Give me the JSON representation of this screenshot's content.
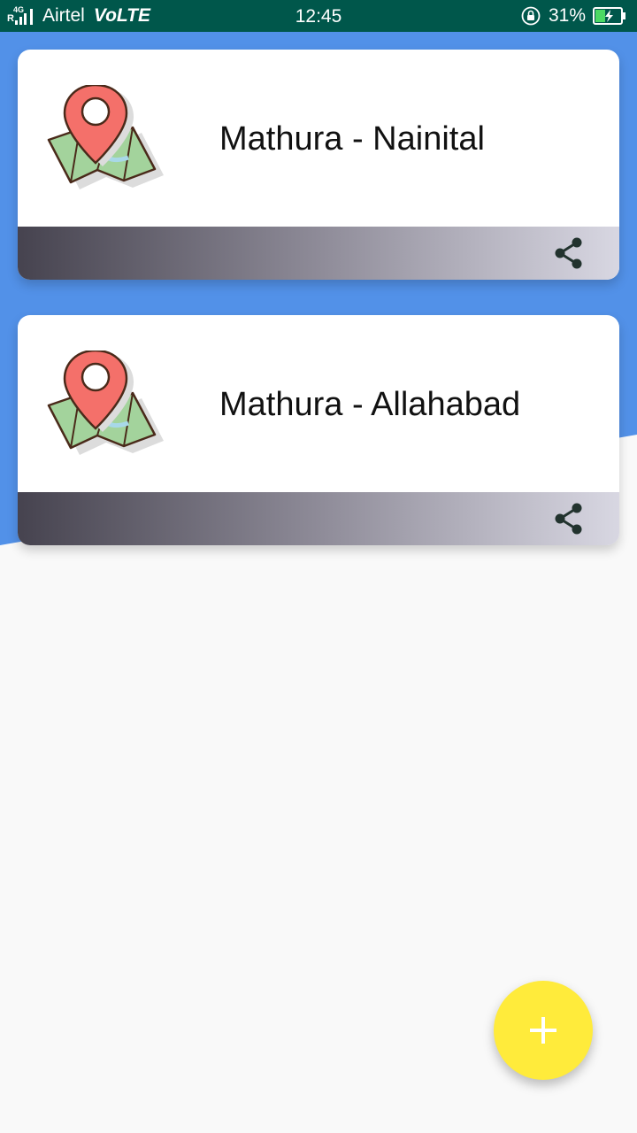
{
  "status_bar": {
    "network": "4G",
    "roaming": "R",
    "carrier": "Airtel",
    "volte": "VoLTE",
    "time": "12:45",
    "battery_percent": "31%",
    "icons": [
      "signal-icon",
      "rotation-lock-icon",
      "battery-charging-icon"
    ]
  },
  "cards": [
    {
      "title": "Mathura - Nainital",
      "icon": "map-pin-icon",
      "action_icon": "share-icon"
    },
    {
      "title": "Mathura - Allahabad",
      "icon": "map-pin-icon",
      "action_icon": "share-icon"
    }
  ],
  "fab": {
    "icon": "plus-icon"
  },
  "colors": {
    "status_bar": "#00574b",
    "header_blue": "#5291e8",
    "background": "#f9f9f9",
    "fab": "#ffeb3b",
    "card_footer_start": "#46434f",
    "card_footer_end": "#d8d7e2",
    "title_text": "#111111"
  }
}
